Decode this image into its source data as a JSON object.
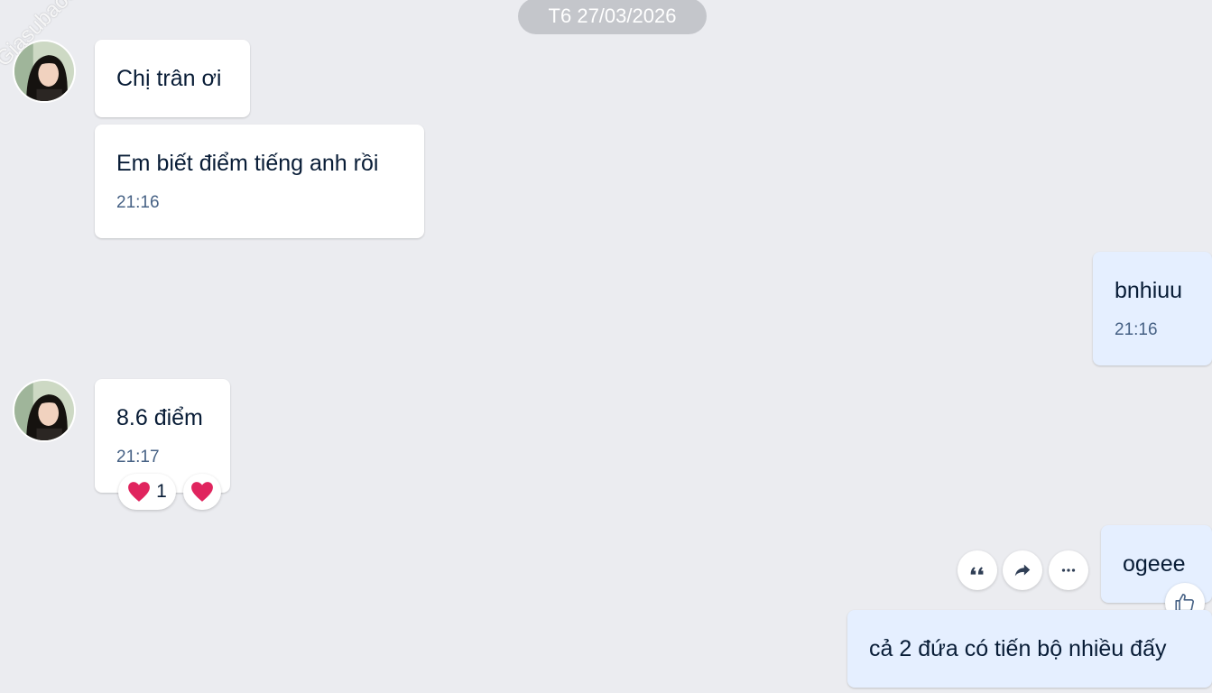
{
  "date_separator": "T6 27/03/2026",
  "watermark": "Giasubaochau.net",
  "messages": [
    {
      "text": "Chị trân ơi"
    },
    {
      "text": "Em biết điểm tiếng anh rồi",
      "time": "21:16"
    },
    {
      "text": "bnhiuu",
      "time": "21:16"
    },
    {
      "text": "8.6 điểm",
      "time": "21:17",
      "reaction_count": "1"
    },
    {
      "text": "ogeee"
    },
    {
      "text": "cả 2 đứa có tiến bộ nhiều đấy"
    }
  ],
  "icons": {
    "avatar": "contact-avatar",
    "reaction": "heart-icon",
    "quote": "quote-icon",
    "forward": "forward-icon",
    "more": "more-icon",
    "like": "thumbs-up-icon"
  },
  "colors": {
    "background": "#ebecf0",
    "incoming_bubble": "#ffffff",
    "outgoing_bubble": "#e5efff",
    "time_text": "#476285",
    "heart": "#e0245e"
  }
}
